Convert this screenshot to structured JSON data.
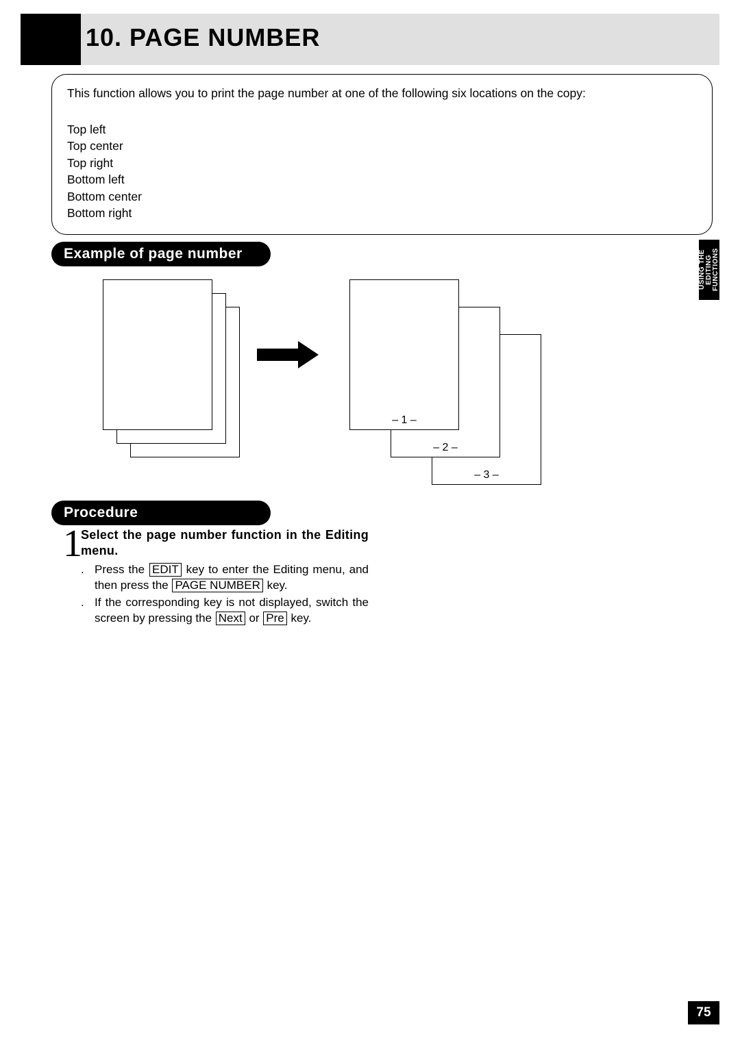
{
  "chapter": "10. PAGE NUMBER",
  "intro": "This function allows you to print the page number at one of the following six locations on the copy:",
  "locations": [
    "Top left",
    "Top center",
    "Top right",
    "Bottom left",
    "Bottom center",
    "Bottom right"
  ],
  "section_example": "Example of page number",
  "section_procedure": "Procedure",
  "diagram_pages": [
    "– 1 –",
    "– 2 –",
    "– 3 –"
  ],
  "side_tab": "USING THE EDITING FUNCTIONS",
  "step1": {
    "num": "1",
    "title": "Select the page number function in the Editing menu.",
    "line1_a": "Press the ",
    "line1_key1": "EDIT",
    "line1_b": " key to enter the Editing menu, and then press the ",
    "line1_key2": "PAGE NUMBER",
    "line1_c": " key.",
    "line2_a": "If the corresponding key is not displayed, switch the screen by pressing the ",
    "line2_key1": "Next",
    "line2_b": " or ",
    "line2_key2": "Pre",
    "line2_c": "  key."
  },
  "page_number": "75"
}
